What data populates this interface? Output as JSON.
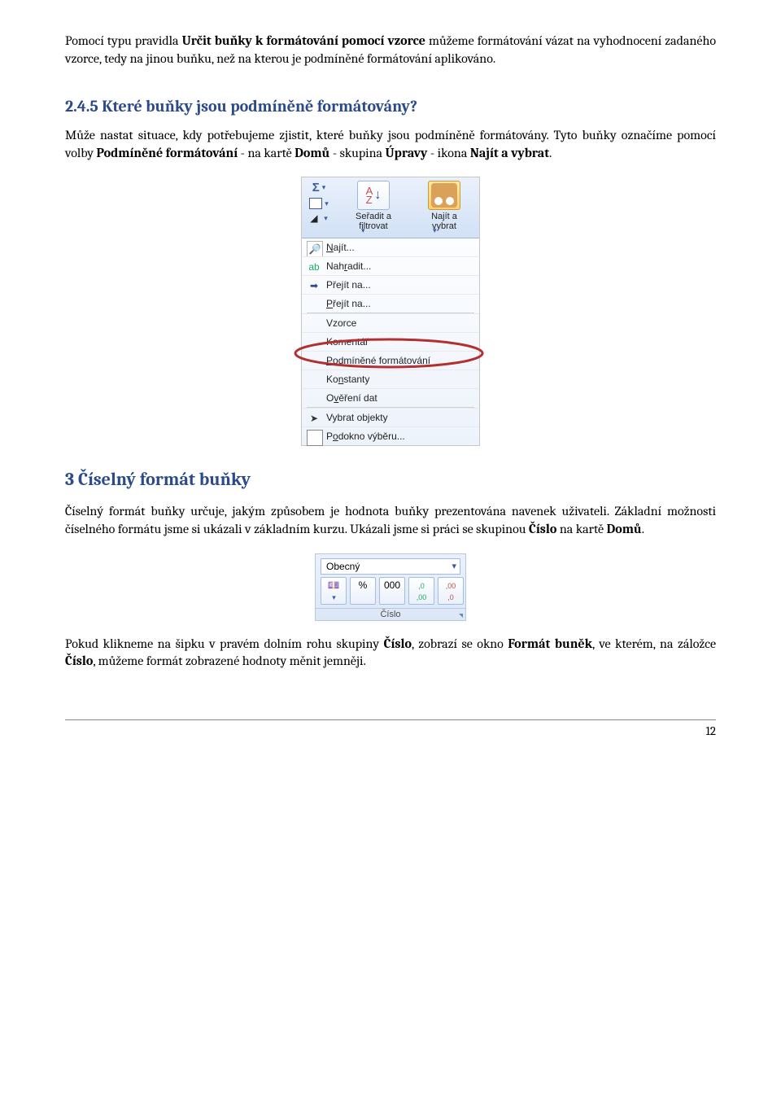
{
  "intro": {
    "p1_prefix": "Pomocí typu pravidla ",
    "p1_bold": "Určit buňky k formátování pomocí vzorce",
    "p1_rest": " můžeme formátování vázat na vyhodnocení zadaného vzorce, tedy na jinou buňku, než na kterou je podmíněné formátování aplikováno."
  },
  "h245": "2.4.5 Které buňky jsou podmíněně formátovány?",
  "p2_a": "Může nastat situace, kdy potřebujeme zjistit, které buňky jsou podmíněně formátovány. Tyto buňky označíme pomocí volby ",
  "p2_b1": "Podmíněné formátování",
  "p2_b2": " - na kartě ",
  "p2_b3": "Domů",
  "p2_b4": " - skupina ",
  "p2_b5": "Úpravy",
  "p2_b6": " - ikona ",
  "p2_b7": "Najít a vybrat",
  "p2_end": ".",
  "ribbon": {
    "sort_label": "Seřadit a\nfiltrovat",
    "find_label": "Najít a\nvybrat"
  },
  "menu": {
    "najit": "Najít...",
    "nahradit": "Nahradit...",
    "prejit1": "Přejít na...",
    "prejit2": "Přejít na...",
    "vzorce": "Vzorce",
    "komentar": "Komentář",
    "podm": "Podmíněné formátování",
    "konstanty": "Konstanty",
    "overeni": "Ověření dat",
    "vybratobj": "Vybrat objekty",
    "podokno": "Podokno výběru..."
  },
  "h3": "3   Číselný formát buňky",
  "p3_a": "Číselný formát buňky určuje, jakým způsobem je hodnota buňky prezentována navenek uživateli. Základní možnosti číselného formátu jsme si ukázali v základním kurzu. Ukázali jsme si práci se skupinou ",
  "p3_b1": "Číslo",
  "p3_b2": " na kartě ",
  "p3_b3": "Domů",
  "p3_end": ".",
  "cislo": {
    "combo": "Obecný",
    "btn_currency": "💷",
    "btn_percent": "%",
    "btn_thousand": "000",
    "btn_inc": ",0\n,00",
    "btn_dec": ",00\n,0",
    "label": "Číslo"
  },
  "p4_a": "Pokud klikneme na šipku v pravém dolním rohu skupiny ",
  "p4_b1": "Číslo",
  "p4_b2": ", zobrazí se okno ",
  "p4_b3": "Formát buněk",
  "p4_b4": ", ve kterém, na záložce ",
  "p4_b5": "Číslo",
  "p4_rest": ", můžeme formát zobrazené hodnoty měnit jemněji.",
  "pagenum": "12"
}
